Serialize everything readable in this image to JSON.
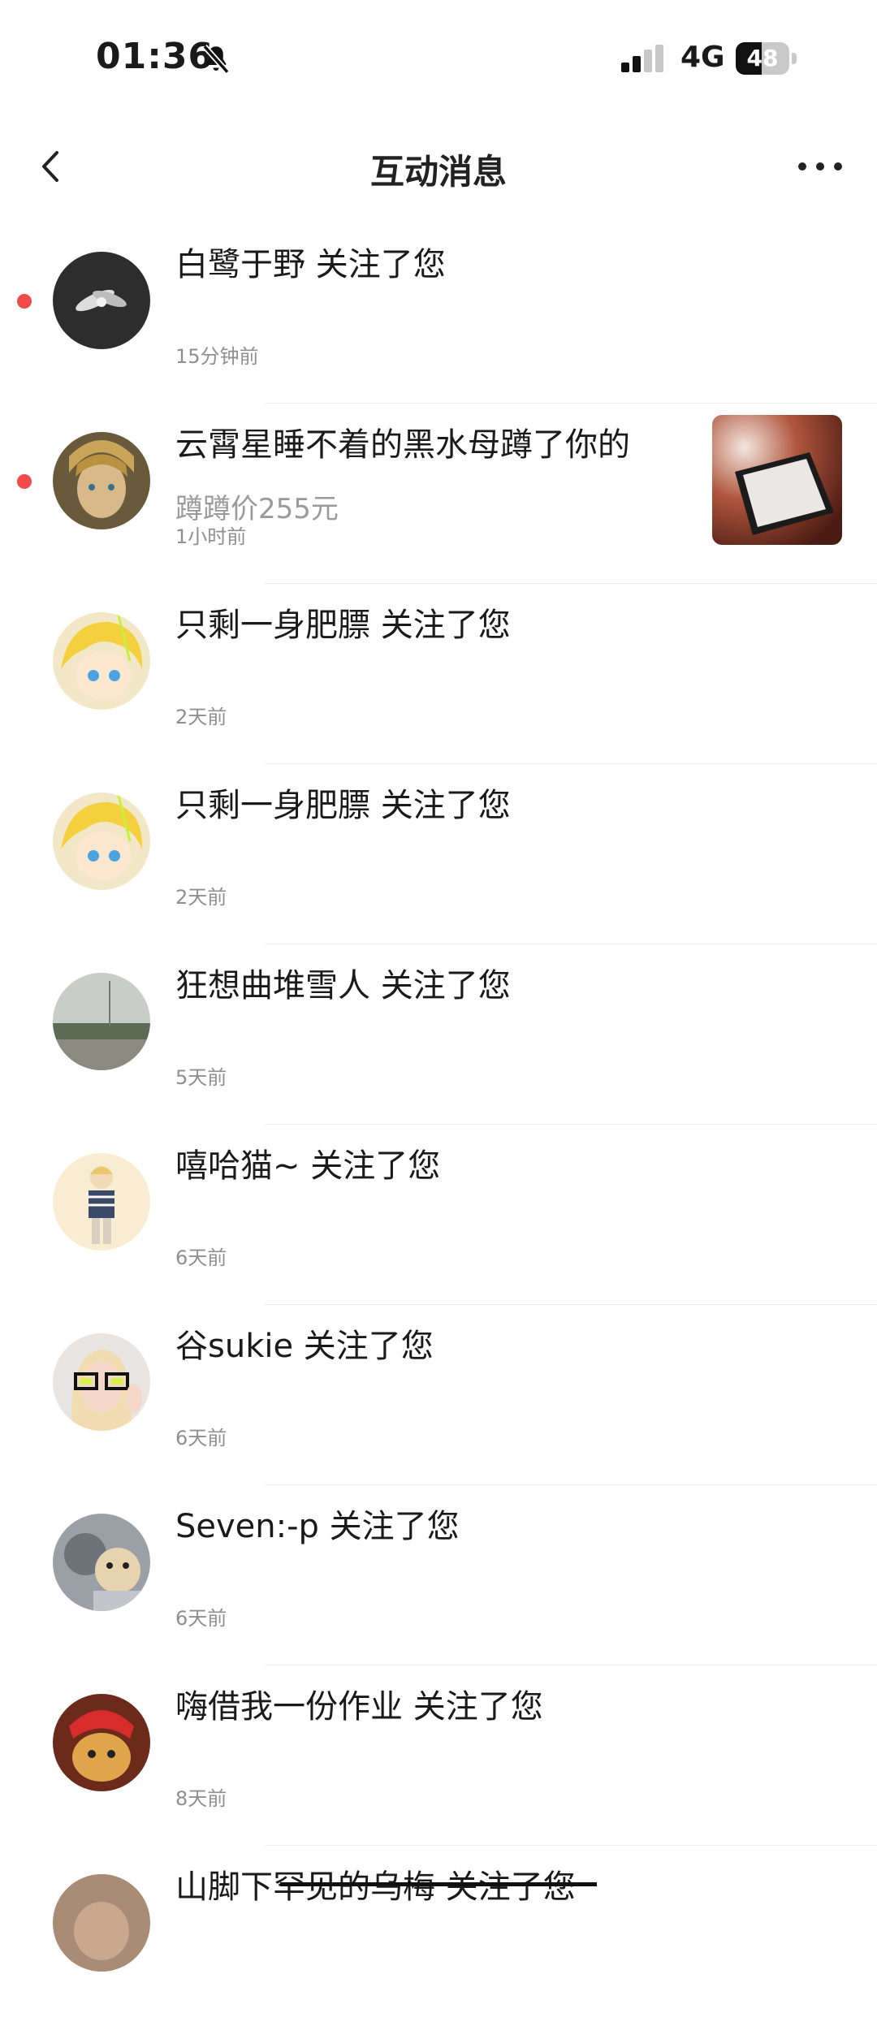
{
  "status_bar": {
    "time": "01:36",
    "network": "4G",
    "battery": "48",
    "battery_level": 0.48
  },
  "nav": {
    "title": "互动消息"
  },
  "notifications": [
    {
      "unread": true,
      "text": "白鹭于野 关注了您",
      "time": "15分钟前"
    },
    {
      "unread": true,
      "text": "云霄星睡不着的黑水母蹲了你的",
      "subtext": "蹲蹲价255元",
      "time": "1小时前",
      "has_thumbnail": true
    },
    {
      "unread": false,
      "text": "只剩一身肥膘 关注了您",
      "time": "2天前"
    },
    {
      "unread": false,
      "text": "只剩一身肥膘 关注了您",
      "time": "2天前"
    },
    {
      "unread": false,
      "text": "狂想曲堆雪人 关注了您",
      "time": "5天前"
    },
    {
      "unread": false,
      "text": "嘻哈猫~ 关注了您",
      "time": "6天前"
    },
    {
      "unread": false,
      "text": "谷sukie 关注了您",
      "time": "6天前"
    },
    {
      "unread": false,
      "text": "Seven:-p 关注了您",
      "time": "6天前"
    },
    {
      "unread": false,
      "text": "嗨借我一份作业 关注了您",
      "time": "8天前"
    },
    {
      "unread": false,
      "text": "山脚下罕见的乌梅 关注了您"
    }
  ],
  "colors": {
    "unread_dot": "#f04a4a",
    "meta_text": "#9a9a9a",
    "separator": "#eeeeee"
  }
}
